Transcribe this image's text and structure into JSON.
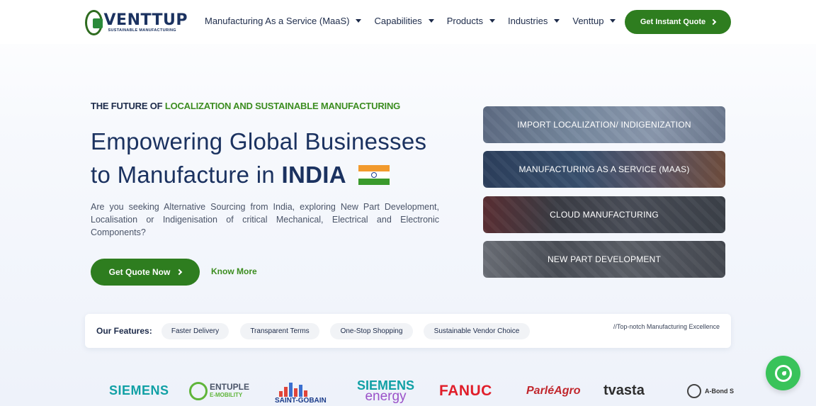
{
  "header": {
    "logo_word": "VENTTUP",
    "logo_tagline": "SUSTAINABLE MANUFACTURING",
    "nav": [
      {
        "label": "Manufacturing As a Service (MaaS)"
      },
      {
        "label": "Capabilities"
      },
      {
        "label": "Products"
      },
      {
        "label": "Industries"
      },
      {
        "label": "Venttup"
      }
    ],
    "cta_label": "Get Instant Quote"
  },
  "hero": {
    "eyebrow_prefix": "THE FUTURE OF",
    "eyebrow_highlight": "LOCALIZATION AND SUSTAINABLE MANUFACTURING",
    "title_line1": "Empowering Global Businesses",
    "title_line2_prefix": "to Manufacture in",
    "title_line2_bold": "INDIA",
    "description": "Are you seeking Alternative Sourcing from India, exploring New Part Development, Localisation or Indigenisation of critical Mechanical, Electrical and Electronic Components?",
    "primary_button": "Get Quote Now",
    "secondary_link": "Know More"
  },
  "services": [
    {
      "label": "IMPORT LOCALIZATION/ INDIGENIZATION"
    },
    {
      "label": "MANUFACTURING AS A SERVICE (MAAS)"
    },
    {
      "label": "CLOUD MANUFACTURING"
    },
    {
      "label": "NEW PART DEVELOPMENT"
    }
  ],
  "features": {
    "label": "Our Features:",
    "chips": [
      "Faster Delivery",
      "Transparent Terms",
      "One-Stop Shopping",
      "Sustainable Vendor Choice"
    ],
    "note": "//Top-notch Manufacturing Excellence"
  },
  "client_logos": {
    "siemens": "SIEMENS",
    "entuple": "ENTUPLE",
    "entuple_sub": "E-MOBILITY",
    "saint_gobain": "SAINT-GOBAIN",
    "siemens_energy_1": "SIEMENS",
    "siemens_energy_2": "energy",
    "fanuc": "FANUC",
    "parle": "ParléAgro",
    "tvasta": "tvasta",
    "abond": "A-Bond S"
  },
  "colors": {
    "brand_green": "#2e7d1f",
    "highlight_green": "#3c8d20",
    "navy": "#1b3260",
    "whatsapp": "#39c35a"
  },
  "icons": {
    "nav_caret": "chevron-down-icon",
    "button_arrow": "chevron-right-icon",
    "whatsapp": "whatsapp-icon",
    "flag": "india-flag-icon"
  }
}
